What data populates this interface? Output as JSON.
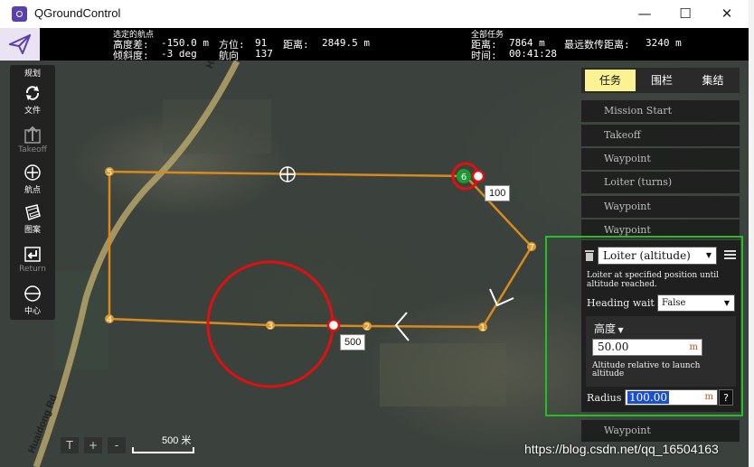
{
  "window": {
    "title": "QGroundControl",
    "minimize": "—",
    "maximize": "☐",
    "close": "✕"
  },
  "toolbar": {
    "selected_wp_header": "选定的航点",
    "alt_diff_label": "高度差:",
    "alt_diff_value": "-150.0 m",
    "gradient_label": "倾斜度:",
    "gradient_value": "-3 deg",
    "azimuth_label": "方位:",
    "azimuth_value": "91",
    "heading_label": "航向",
    "heading_value": "137",
    "distance_label": "距离:",
    "distance_value": "2849.5 m",
    "total_mission_header": "全部任务",
    "total_distance_label": "距离:",
    "total_distance_value": "7864 m",
    "max_telemetry_label": "最远数传距离:",
    "max_telemetry_value": "3240 m",
    "time_label": "时间:",
    "time_value": "00:41:28"
  },
  "plan": {
    "header": "规划",
    "items": [
      {
        "label": "文件",
        "icon": "sync-icon"
      },
      {
        "label": "Takeoff",
        "icon": "takeoff-icon"
      },
      {
        "label": "航点",
        "icon": "waypoint-add-icon"
      },
      {
        "label": "图案",
        "icon": "pattern-icon"
      },
      {
        "label": "Return",
        "icon": "return-icon"
      },
      {
        "label": "中心",
        "icon": "center-icon"
      }
    ]
  },
  "tabs": [
    {
      "label": "任务",
      "active": true
    },
    {
      "label": "围栏",
      "active": false
    },
    {
      "label": "集结",
      "active": false
    }
  ],
  "mission_items": [
    "Mission Start",
    "Takeoff",
    "Waypoint",
    "Loiter (turns)",
    "Waypoint",
    "Waypoint",
    "Waypoint"
  ],
  "editor": {
    "command": "Loiter (altitude)",
    "description": "Loiter at specified position until altitude reached.",
    "heading_wait_label": "Heading wait",
    "heading_wait_value": "False",
    "altitude_label": "高度",
    "altitude_value": "50.00",
    "altitude_unit": "m",
    "altitude_help": "Altitude relative to launch altitude",
    "radius_label": "Radius",
    "radius_value": "100.00",
    "radius_unit": "m",
    "radius_help_btn": "?"
  },
  "map": {
    "waypoints": [
      "1",
      "2",
      "3",
      "4",
      "5",
      "6",
      "7"
    ],
    "loiter_radius_labels": [
      "100",
      "500"
    ],
    "road_labels": [
      "Huaidong Rd",
      "Huaido"
    ],
    "zoom_buttons": [
      "T",
      "+",
      "-"
    ],
    "scale": "500 米"
  },
  "watermark": "https://blog.csdn.net/qq_16504163"
}
